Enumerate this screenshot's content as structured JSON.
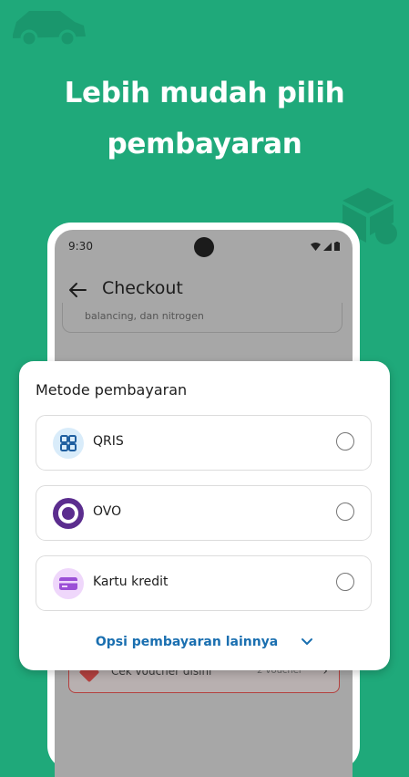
{
  "headline": {
    "line1": "Lebih mudah pilih",
    "line2": "pembayaran"
  },
  "phone": {
    "status_time": "9:30",
    "appbar_title": "Checkout",
    "card_text": "balancing, dan nitrogen",
    "voucher_label": "Cek voucher disini",
    "voucher_count": "2 voucher"
  },
  "sheet": {
    "title": "Metode pembayaran",
    "options": [
      {
        "label": "QRIS",
        "icon": "qris-icon",
        "selected": false
      },
      {
        "label": "OVO",
        "icon": "ovo-icon",
        "selected": false
      },
      {
        "label": "Kartu kredit",
        "icon": "credit-card-icon",
        "selected": false
      }
    ],
    "more_label": "Opsi pembayaran lainnya"
  },
  "colors": {
    "background": "#1fa97a",
    "link": "#1a6fb0",
    "ovo": "#5b2d8e",
    "qris_bg": "#d9ecfa",
    "card_bg": "#efd7fb"
  }
}
